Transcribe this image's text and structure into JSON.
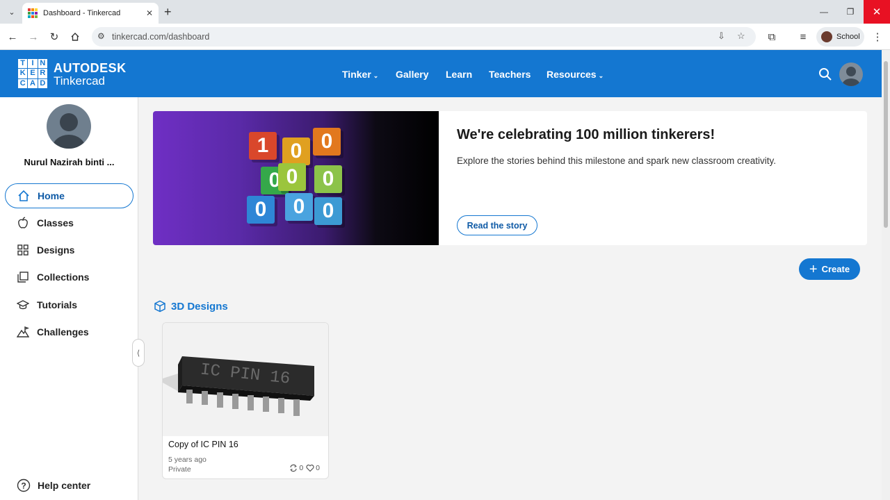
{
  "browser": {
    "tab_title": "Dashboard - Tinkercad",
    "url": "tinkercad.com/dashboard",
    "profile_label": "School"
  },
  "header": {
    "brand_top": "AUTODESK",
    "brand_bottom": "Tinkercad",
    "logo_letters": [
      "TIN",
      "KER",
      "CAD"
    ],
    "nav": [
      {
        "label": "Tinker",
        "has_dropdown": true
      },
      {
        "label": "Gallery",
        "has_dropdown": false
      },
      {
        "label": "Learn",
        "has_dropdown": false
      },
      {
        "label": "Teachers",
        "has_dropdown": false
      },
      {
        "label": "Resources",
        "has_dropdown": true
      }
    ],
    "accent": "#1477d1"
  },
  "sidebar": {
    "user_name": "Nurul Nazirah binti ...",
    "items": [
      {
        "label": "Home",
        "icon": "home-icon",
        "active": true
      },
      {
        "label": "Classes",
        "icon": "apple-icon",
        "active": false
      },
      {
        "label": "Designs",
        "icon": "grid-icon",
        "active": false
      },
      {
        "label": "Collections",
        "icon": "collections-icon",
        "active": false
      },
      {
        "label": "Tutorials",
        "icon": "graduation-cap-icon",
        "active": false
      },
      {
        "label": "Challenges",
        "icon": "mountain-flag-icon",
        "active": false
      }
    ],
    "help_label": "Help center"
  },
  "banner": {
    "title": "We're celebrating 100 million tinkerers!",
    "subtitle": "Explore the stories behind this milestone and spark new classroom creativity.",
    "button_label": "Read the story",
    "cube_digits": [
      "1",
      "0",
      "0",
      "0",
      "0",
      "0",
      "0",
      "0",
      "0"
    ]
  },
  "create_button": "Create",
  "section": {
    "title": "3D Designs"
  },
  "designs": [
    {
      "name": "Copy of IC PIN 16",
      "thumb_text": "IC PIN 16",
      "date": "5 years ago",
      "visibility": "Private",
      "copies": "0",
      "likes": "0"
    }
  ]
}
